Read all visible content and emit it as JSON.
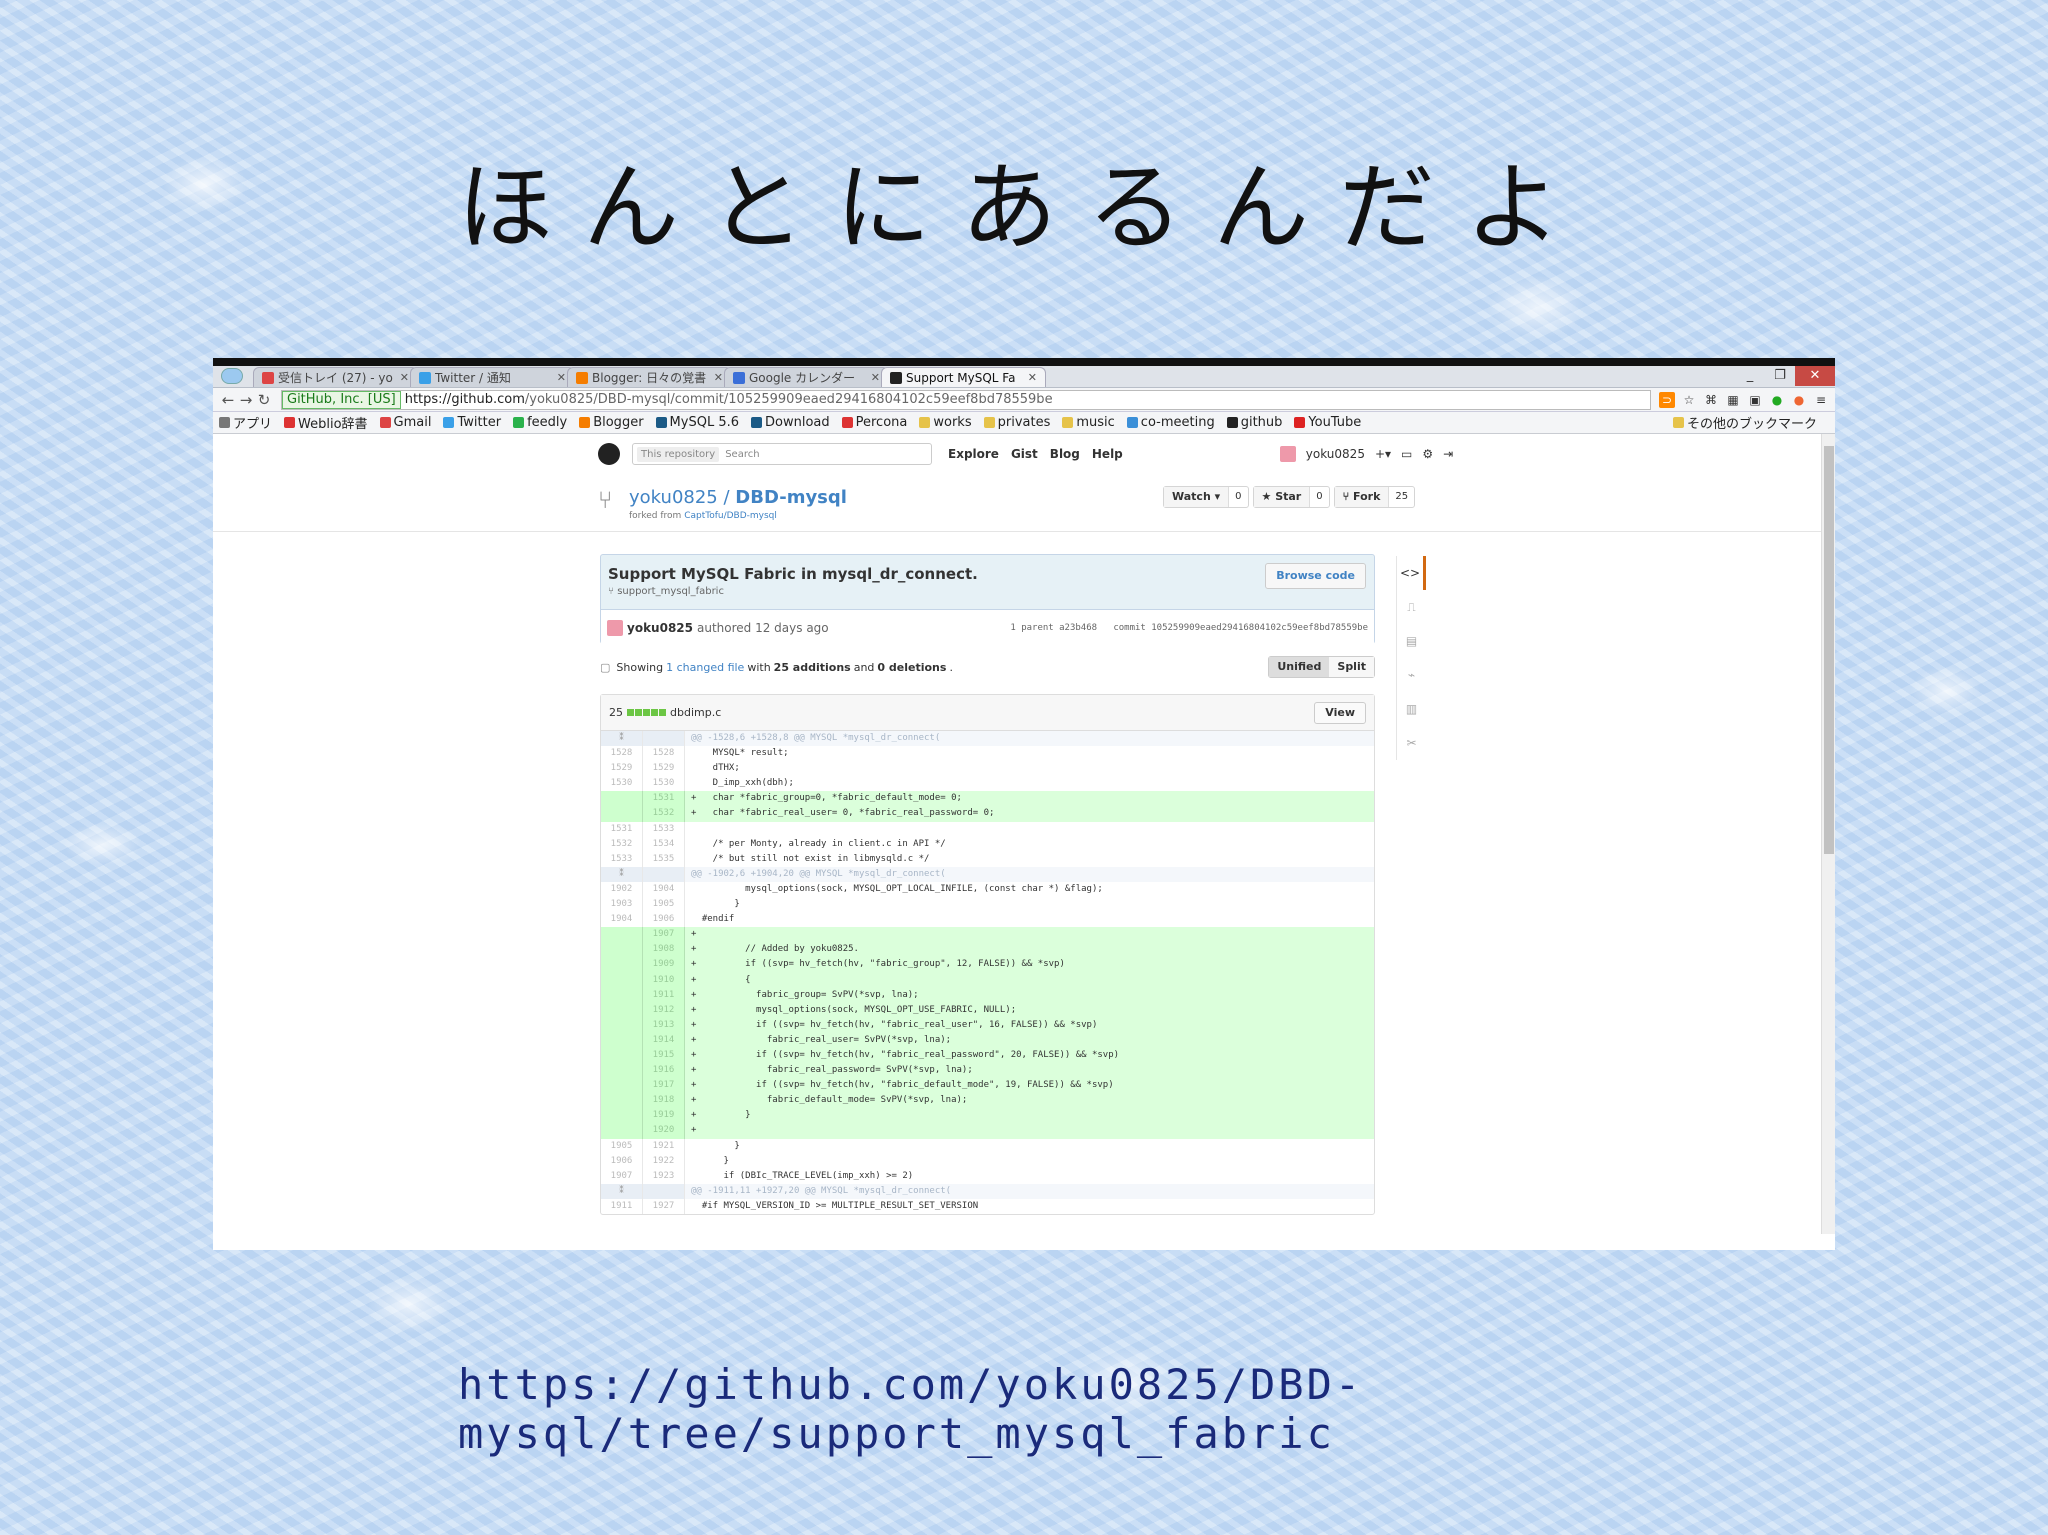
{
  "slide": {
    "title": "ほんとにあるんだよ",
    "url": "https://github.com/yoku0825/DBD-mysql/tree/support_mysql_fabric"
  },
  "browser": {
    "tabs": [
      {
        "label": "受信トレイ (27) - yo",
        "icon_color": "#d44",
        "active": false
      },
      {
        "label": "Twitter / 通知",
        "icon_color": "#3aa0e8",
        "active": false
      },
      {
        "label": "Blogger: 日々の覚書",
        "icon_color": "#f57d00",
        "active": false
      },
      {
        "label": "Google カレンダー",
        "icon_color": "#3b6fd8",
        "active": false
      },
      {
        "label": "Support MySQL Fa",
        "icon_color": "#222",
        "active": true
      }
    ],
    "window_controls": {
      "minimize": "_",
      "maximize": "❐",
      "close": "✕"
    },
    "address": {
      "secure_label": "GitHub, Inc. [US]",
      "host": "https://github.com",
      "path": "/yoku0825/DBD-mysql/commit/105259909eaed29416804102c59eef8bd78559be"
    },
    "bookmarks": [
      {
        "label": "アプリ",
        "icon_color": "#777"
      },
      {
        "label": "Weblio辞書",
        "icon_color": "#d33"
      },
      {
        "label": "Gmail",
        "icon_color": "#d44"
      },
      {
        "label": "Twitter",
        "icon_color": "#3aa0e8"
      },
      {
        "label": "feedly",
        "icon_color": "#2bb24c"
      },
      {
        "label": "Blogger",
        "icon_color": "#f57d00"
      },
      {
        "label": "MySQL 5.6",
        "icon_color": "#1b5a86"
      },
      {
        "label": "Download",
        "icon_color": "#1b5a86"
      },
      {
        "label": "Percona",
        "icon_color": "#d33"
      },
      {
        "label": "works",
        "icon_color": "#e6c34a"
      },
      {
        "label": "privates",
        "icon_color": "#e6c34a"
      },
      {
        "label": "music",
        "icon_color": "#e6c34a"
      },
      {
        "label": "co-meeting",
        "icon_color": "#3b8fd8"
      },
      {
        "label": "github",
        "icon_color": "#222"
      },
      {
        "label": "YouTube",
        "icon_color": "#d22"
      }
    ],
    "other_bookmarks": "その他のブックマーク"
  },
  "github": {
    "search_scope": "This repository",
    "search_placeholder": "Search",
    "nav": [
      "Explore",
      "Gist",
      "Blog",
      "Help"
    ],
    "username": "yoku0825",
    "plus": "+▾",
    "repo_owner": "yoku0825",
    "repo_sep": " / ",
    "repo_name": "DBD-mysql",
    "forked_prefix": "forked from ",
    "forked_from": "CaptTofu/DBD-mysql",
    "watch_label": "Watch ▾",
    "watch_count": "0",
    "star_label": "★ Star",
    "star_count": "0",
    "fork_label": "Fork",
    "fork_count": "25",
    "commit": {
      "title": "Support MySQL Fabric in mysql_dr_connect.",
      "branch": "support_mysql_fabric",
      "browse_code": "Browse code",
      "author": "yoku0825",
      "authored": "authored 12 days ago",
      "parent": "1 parent a23b468",
      "commit_label": "commit 105259909eaed29416804102c59eef8bd78559be"
    },
    "summary": {
      "showing": "Showing",
      "changed": "1 changed file",
      "with": "with",
      "additions": "25 additions",
      "and": "and",
      "deletions": "0 deletions",
      "unified": "Unified",
      "split": "Split"
    },
    "file": {
      "count": "25",
      "name": "dbdimp.c",
      "view": "View"
    },
    "diff": [
      {
        "t": "hunk",
        "a": "",
        "b": "",
        "c": "@@ -1528,6 +1528,8 @@ MYSQL *mysql_dr_connect("
      },
      {
        "t": "ctx",
        "a": "1528",
        "b": "1528",
        "c": "    MYSQL* result;"
      },
      {
        "t": "ctx",
        "a": "1529",
        "b": "1529",
        "c": "    dTHX;"
      },
      {
        "t": "ctx",
        "a": "1530",
        "b": "1530",
        "c": "    D_imp_xxh(dbh);"
      },
      {
        "t": "add",
        "a": "",
        "b": "1531",
        "c": "+   char *fabric_group=0, *fabric_default_mode= 0;"
      },
      {
        "t": "add",
        "a": "",
        "b": "1532",
        "c": "+   char *fabric_real_user= 0, *fabric_real_password= 0;"
      },
      {
        "t": "ctx",
        "a": "1531",
        "b": "1533",
        "c": ""
      },
      {
        "t": "ctx",
        "a": "1532",
        "b": "1534",
        "c": "    /* per Monty, already in client.c in API */"
      },
      {
        "t": "ctx",
        "a": "1533",
        "b": "1535",
        "c": "    /* but still not exist in libmysqld.c */"
      },
      {
        "t": "hunk",
        "a": "",
        "b": "",
        "c": "@@ -1902,6 +1904,20 @@ MYSQL *mysql_dr_connect("
      },
      {
        "t": "ctx",
        "a": "1902",
        "b": "1904",
        "c": "          mysql_options(sock, MYSQL_OPT_LOCAL_INFILE, (const char *) &flag);"
      },
      {
        "t": "ctx",
        "a": "1903",
        "b": "1905",
        "c": "        }"
      },
      {
        "t": "ctx",
        "a": "1904",
        "b": "1906",
        "c": "  #endif"
      },
      {
        "t": "add",
        "a": "",
        "b": "1907",
        "c": "+"
      },
      {
        "t": "add",
        "a": "",
        "b": "1908",
        "c": "+         // Added by yoku0825."
      },
      {
        "t": "add",
        "a": "",
        "b": "1909",
        "c": "+         if ((svp= hv_fetch(hv, \"fabric_group\", 12, FALSE)) && *svp)"
      },
      {
        "t": "add",
        "a": "",
        "b": "1910",
        "c": "+         {"
      },
      {
        "t": "add",
        "a": "",
        "b": "1911",
        "c": "+           fabric_group= SvPV(*svp, lna);"
      },
      {
        "t": "add",
        "a": "",
        "b": "1912",
        "c": "+           mysql_options(sock, MYSQL_OPT_USE_FABRIC, NULL);"
      },
      {
        "t": "add",
        "a": "",
        "b": "1913",
        "c": "+           if ((svp= hv_fetch(hv, \"fabric_real_user\", 16, FALSE)) && *svp)"
      },
      {
        "t": "add",
        "a": "",
        "b": "1914",
        "c": "+             fabric_real_user= SvPV(*svp, lna);"
      },
      {
        "t": "add",
        "a": "",
        "b": "1915",
        "c": "+           if ((svp= hv_fetch(hv, \"fabric_real_password\", 20, FALSE)) && *svp)"
      },
      {
        "t": "add",
        "a": "",
        "b": "1916",
        "c": "+             fabric_real_password= SvPV(*svp, lna);"
      },
      {
        "t": "add",
        "a": "",
        "b": "1917",
        "c": "+           if ((svp= hv_fetch(hv, \"fabric_default_mode\", 19, FALSE)) && *svp)"
      },
      {
        "t": "add",
        "a": "",
        "b": "1918",
        "c": "+             fabric_default_mode= SvPV(*svp, lna);"
      },
      {
        "t": "add",
        "a": "",
        "b": "1919",
        "c": "+         }"
      },
      {
        "t": "add",
        "a": "",
        "b": "1920",
        "c": "+"
      },
      {
        "t": "ctx",
        "a": "1905",
        "b": "1921",
        "c": "        }"
      },
      {
        "t": "ctx",
        "a": "1906",
        "b": "1922",
        "c": "      }"
      },
      {
        "t": "ctx",
        "a": "1907",
        "b": "1923",
        "c": "      if (DBIc_TRACE_LEVEL(imp_xxh) >= 2)"
      },
      {
        "t": "hunk",
        "a": "",
        "b": "",
        "c": "@@ -1911,11 +1927,20 @@ MYSQL *mysql_dr_connect("
      },
      {
        "t": "ctx",
        "a": "1911",
        "b": "1927",
        "c": "  #if MYSQL_VERSION_ID >= MULTIPLE_RESULT_SET_VERSION"
      }
    ],
    "side_nav": [
      "<>",
      "⎍",
      "▤",
      "⌁",
      "▥",
      "✂"
    ]
  }
}
